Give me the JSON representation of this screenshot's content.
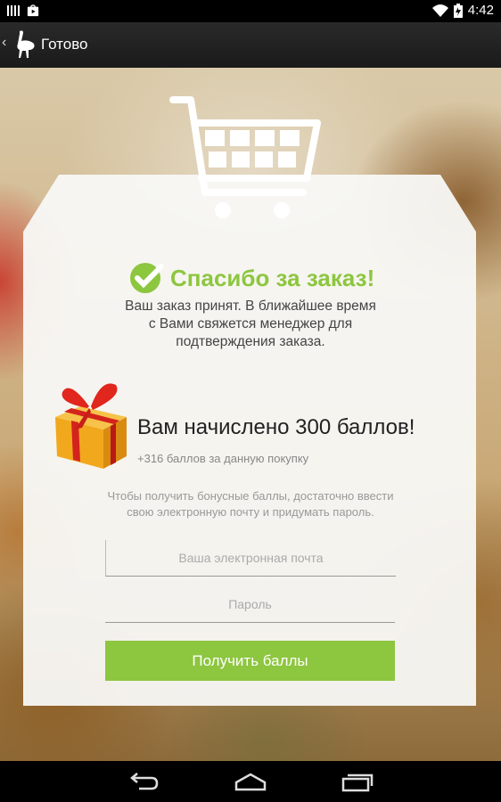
{
  "status_bar": {
    "time": "4:42",
    "icons": [
      "bars-icon",
      "play-store-icon",
      "wifi-icon",
      "battery-icon"
    ]
  },
  "action_bar": {
    "title": "Готово",
    "icons": [
      "back-chevron-icon",
      "ostrich-logo-icon"
    ]
  },
  "card": {
    "thanks_title": "Спасибо за заказ!",
    "accepted_text": "Ваш заказ принят. В ближайшее время\nс Вами свяжется менеджер для\nподтверждения заказа.",
    "points_title": "Вам начислено 300 баллов!",
    "points_sub": "+316 баллов за данную покупку",
    "hint_text": "Чтобы получить бонусные баллы, достаточно ввести\nсвою электронную почту и придумать пароль.",
    "email_placeholder": "Ваша электронная почта",
    "password_placeholder": "Пароль",
    "submit_label": "Получить баллы",
    "accent_color": "#8dc63f"
  },
  "nav_bar": {
    "icons": [
      "back-icon",
      "home-icon",
      "recent-apps-icon"
    ]
  }
}
